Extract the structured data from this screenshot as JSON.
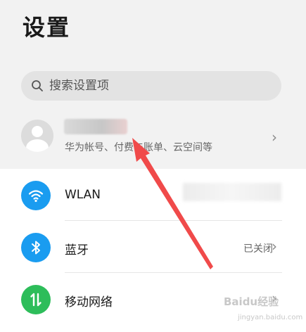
{
  "header": {
    "title": "设置"
  },
  "search": {
    "placeholder": "搜索设置项"
  },
  "account": {
    "subtitle": "华为帐号、付费与账单、云空间等"
  },
  "settings": [
    {
      "label": "WLAN",
      "value": "",
      "icon": "wifi-icon",
      "color": "#1a9cf0"
    },
    {
      "label": "蓝牙",
      "value": "已关闭",
      "icon": "bluetooth-icon",
      "color": "#1a9cf0"
    },
    {
      "label": "移动网络",
      "value": "",
      "icon": "mobile-data-icon",
      "color": "#2dbd5a"
    }
  ],
  "watermark": {
    "brand": "Baidu经验",
    "url": "jingyan.baidu.com"
  },
  "colors": {
    "accent": "#1a9cf0",
    "network_green": "#2dbd5a",
    "annotation_arrow": "#f04a4a"
  }
}
